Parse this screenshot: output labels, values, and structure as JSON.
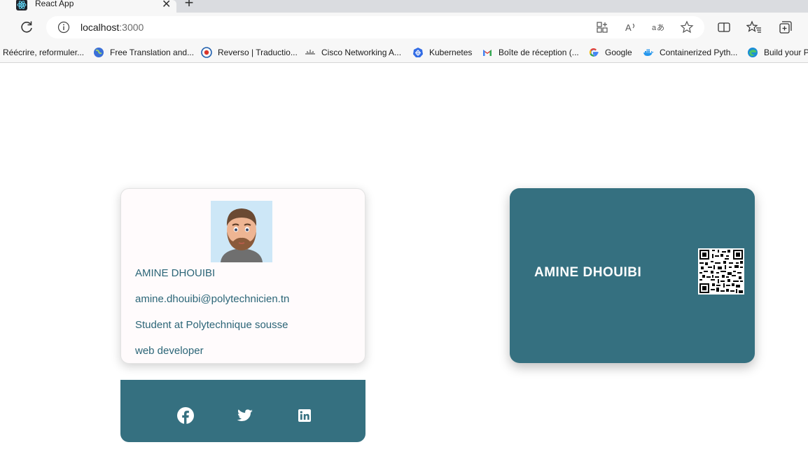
{
  "browser": {
    "tab_title": "React App",
    "tab_close": "✕",
    "new_tab": "+",
    "url_host": "localhost",
    "url_port": ":3000"
  },
  "bookmarks": [
    {
      "label": "Réécrire, reformuler...",
      "icon": "none"
    },
    {
      "label": "Free Translation and...",
      "icon": "globe-icon"
    },
    {
      "label": "Reverso | Traductio...",
      "icon": "reverso-icon"
    },
    {
      "label": "Cisco Networking A...",
      "icon": "cisco-icon"
    },
    {
      "label": "Kubernetes",
      "icon": "kubernetes-icon"
    },
    {
      "label": "Boîte de réception (...",
      "icon": "gmail-icon"
    },
    {
      "label": "Google",
      "icon": "google-icon"
    },
    {
      "label": "Containerized Pyth...",
      "icon": "docker-icon"
    },
    {
      "label": "Build your P",
      "icon": "edge-icon"
    }
  ],
  "profile": {
    "name": "AMINE DHOUIBI",
    "email": "amine.dhouibi@polytechnicien.tn",
    "school": "Student at Polytechnique sousse",
    "role": "web developer"
  },
  "social": [
    "facebook-icon",
    "twitter-icon",
    "linkedin-icon"
  ],
  "business_card": {
    "name": "AMINE DHOUIBI"
  },
  "colors": {
    "accent": "#357080",
    "text_teal": "#2b6577",
    "card_bg": "#fffbfc"
  }
}
